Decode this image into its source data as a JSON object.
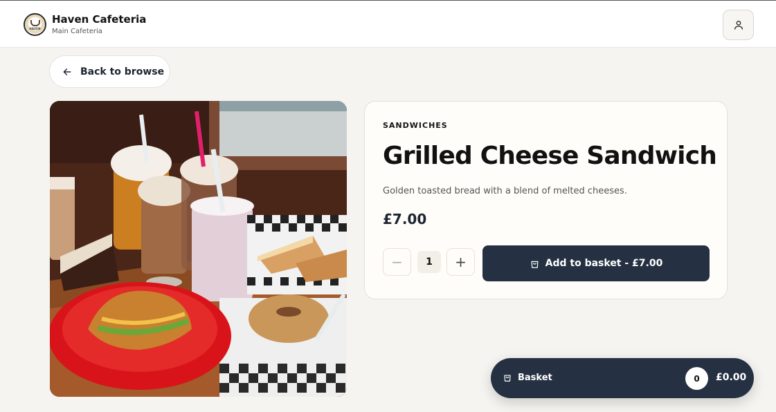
{
  "header": {
    "brand_name": "Haven Cafeteria",
    "location": "Main Cafeteria",
    "logo_text": "HAVEN",
    "account_icon": "user-icon"
  },
  "navigation": {
    "back_label": "Back to browse",
    "back_icon": "arrow-left-icon"
  },
  "product": {
    "category": "SANDWICHES",
    "name": "Grilled Cheese Sandwich",
    "description": "Golden toasted bread with a blend of melted cheeses.",
    "price": "£7.00",
    "image_subject": "cafe spread with drinks, croissant sandwich, grilled sandwich, bagel and cake"
  },
  "quantity": {
    "minus": "−",
    "value": "1",
    "plus": "+"
  },
  "add_to_basket": {
    "label": "Add to basket - £7.00",
    "icon": "shopping-bag-icon"
  },
  "basket": {
    "label": "Basket",
    "count": "0",
    "total": "£0.00",
    "icon": "shopping-bag-icon"
  },
  "colors": {
    "page_background": "#f5f4f0",
    "primary_dark": "#253142",
    "card_background": "#fffdf9"
  }
}
